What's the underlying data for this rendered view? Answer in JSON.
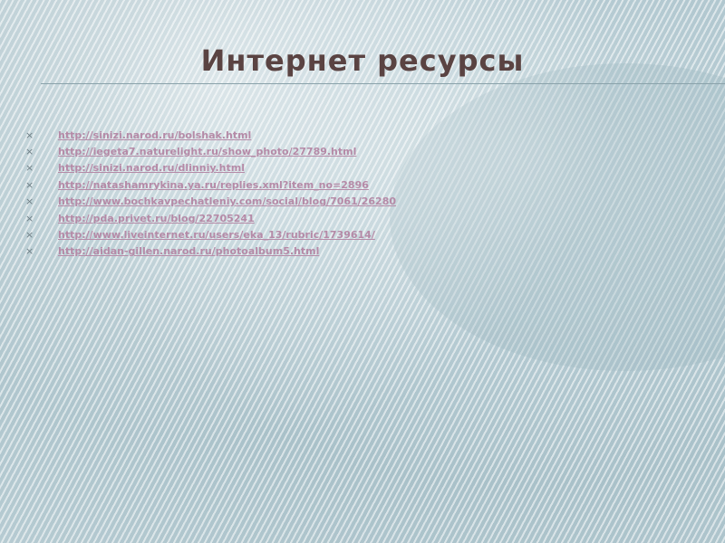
{
  "slide": {
    "title": "Интернет ресурсы",
    "bullet_icon": "×",
    "links": [
      "http://sinizi.narod.ru/bolshak.html",
      "http://iegeta7.naturelight.ru/show_photo/27789.html",
      "http://sinizi.narod.ru/dlinniy.html",
      "http://natashamrykina.ya.ru/replies.xml?item_no=2896",
      "http://www.bochkavpechatleniy.com/social/blog/7061/26280",
      "http://pda.privet.ru/blog/22705241",
      "http://www.liveinternet.ru/users/eka_13/rubric/1739614/",
      "http://aidan-gillen.narod.ru/photoalbum5.html"
    ]
  },
  "colors": {
    "title": "#5a4342",
    "link": "#b58aa7",
    "bullet": "#6e7f86",
    "background": "#b3c9d1"
  }
}
